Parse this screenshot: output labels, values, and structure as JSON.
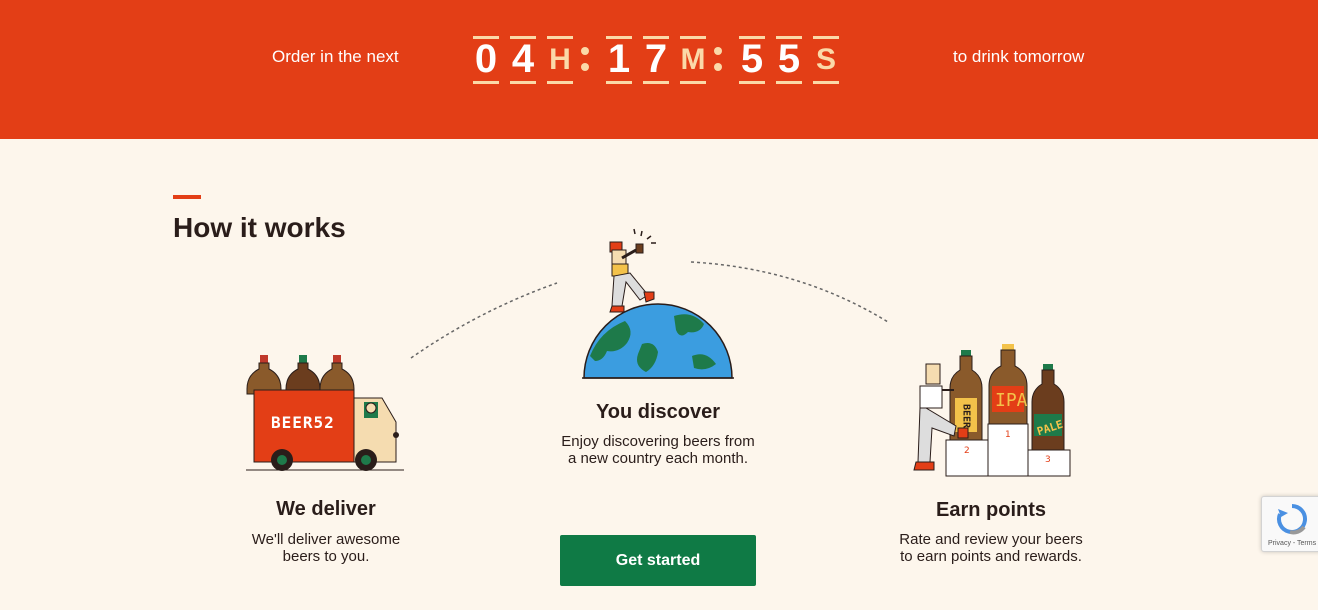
{
  "countdown": {
    "prefix": "Order in the next",
    "suffix": "to drink tomorrow",
    "hours": [
      "0",
      "4"
    ],
    "hours_unit": "H",
    "minutes": [
      "1",
      "7"
    ],
    "minutes_unit": "M",
    "seconds": [
      "5",
      "5"
    ],
    "seconds_unit": "S"
  },
  "section": {
    "title": "How it works"
  },
  "steps": [
    {
      "title": "We deliver",
      "desc_line1": "We'll deliver awesome",
      "desc_line2": "beers to you."
    },
    {
      "title": "You discover",
      "desc_line1": "Enjoy discovering beers from",
      "desc_line2": "a new country each month."
    },
    {
      "title": "Earn points",
      "desc_line1": "Rate and review your beers",
      "desc_line2": "to earn points and rewards."
    }
  ],
  "illustrations": {
    "truck_brand": "BEER52",
    "podium_beer_labels": [
      "BEER",
      "IPA",
      "PALE"
    ],
    "podium_places": [
      "1",
      "2",
      "3"
    ]
  },
  "cta": {
    "label": "Get started"
  },
  "recaptcha": {
    "links": "Privacy - Terms"
  },
  "colors": {
    "brand_red": "#e33e16",
    "cream": "#fdf6ec",
    "cta_green": "#0f7a45"
  }
}
